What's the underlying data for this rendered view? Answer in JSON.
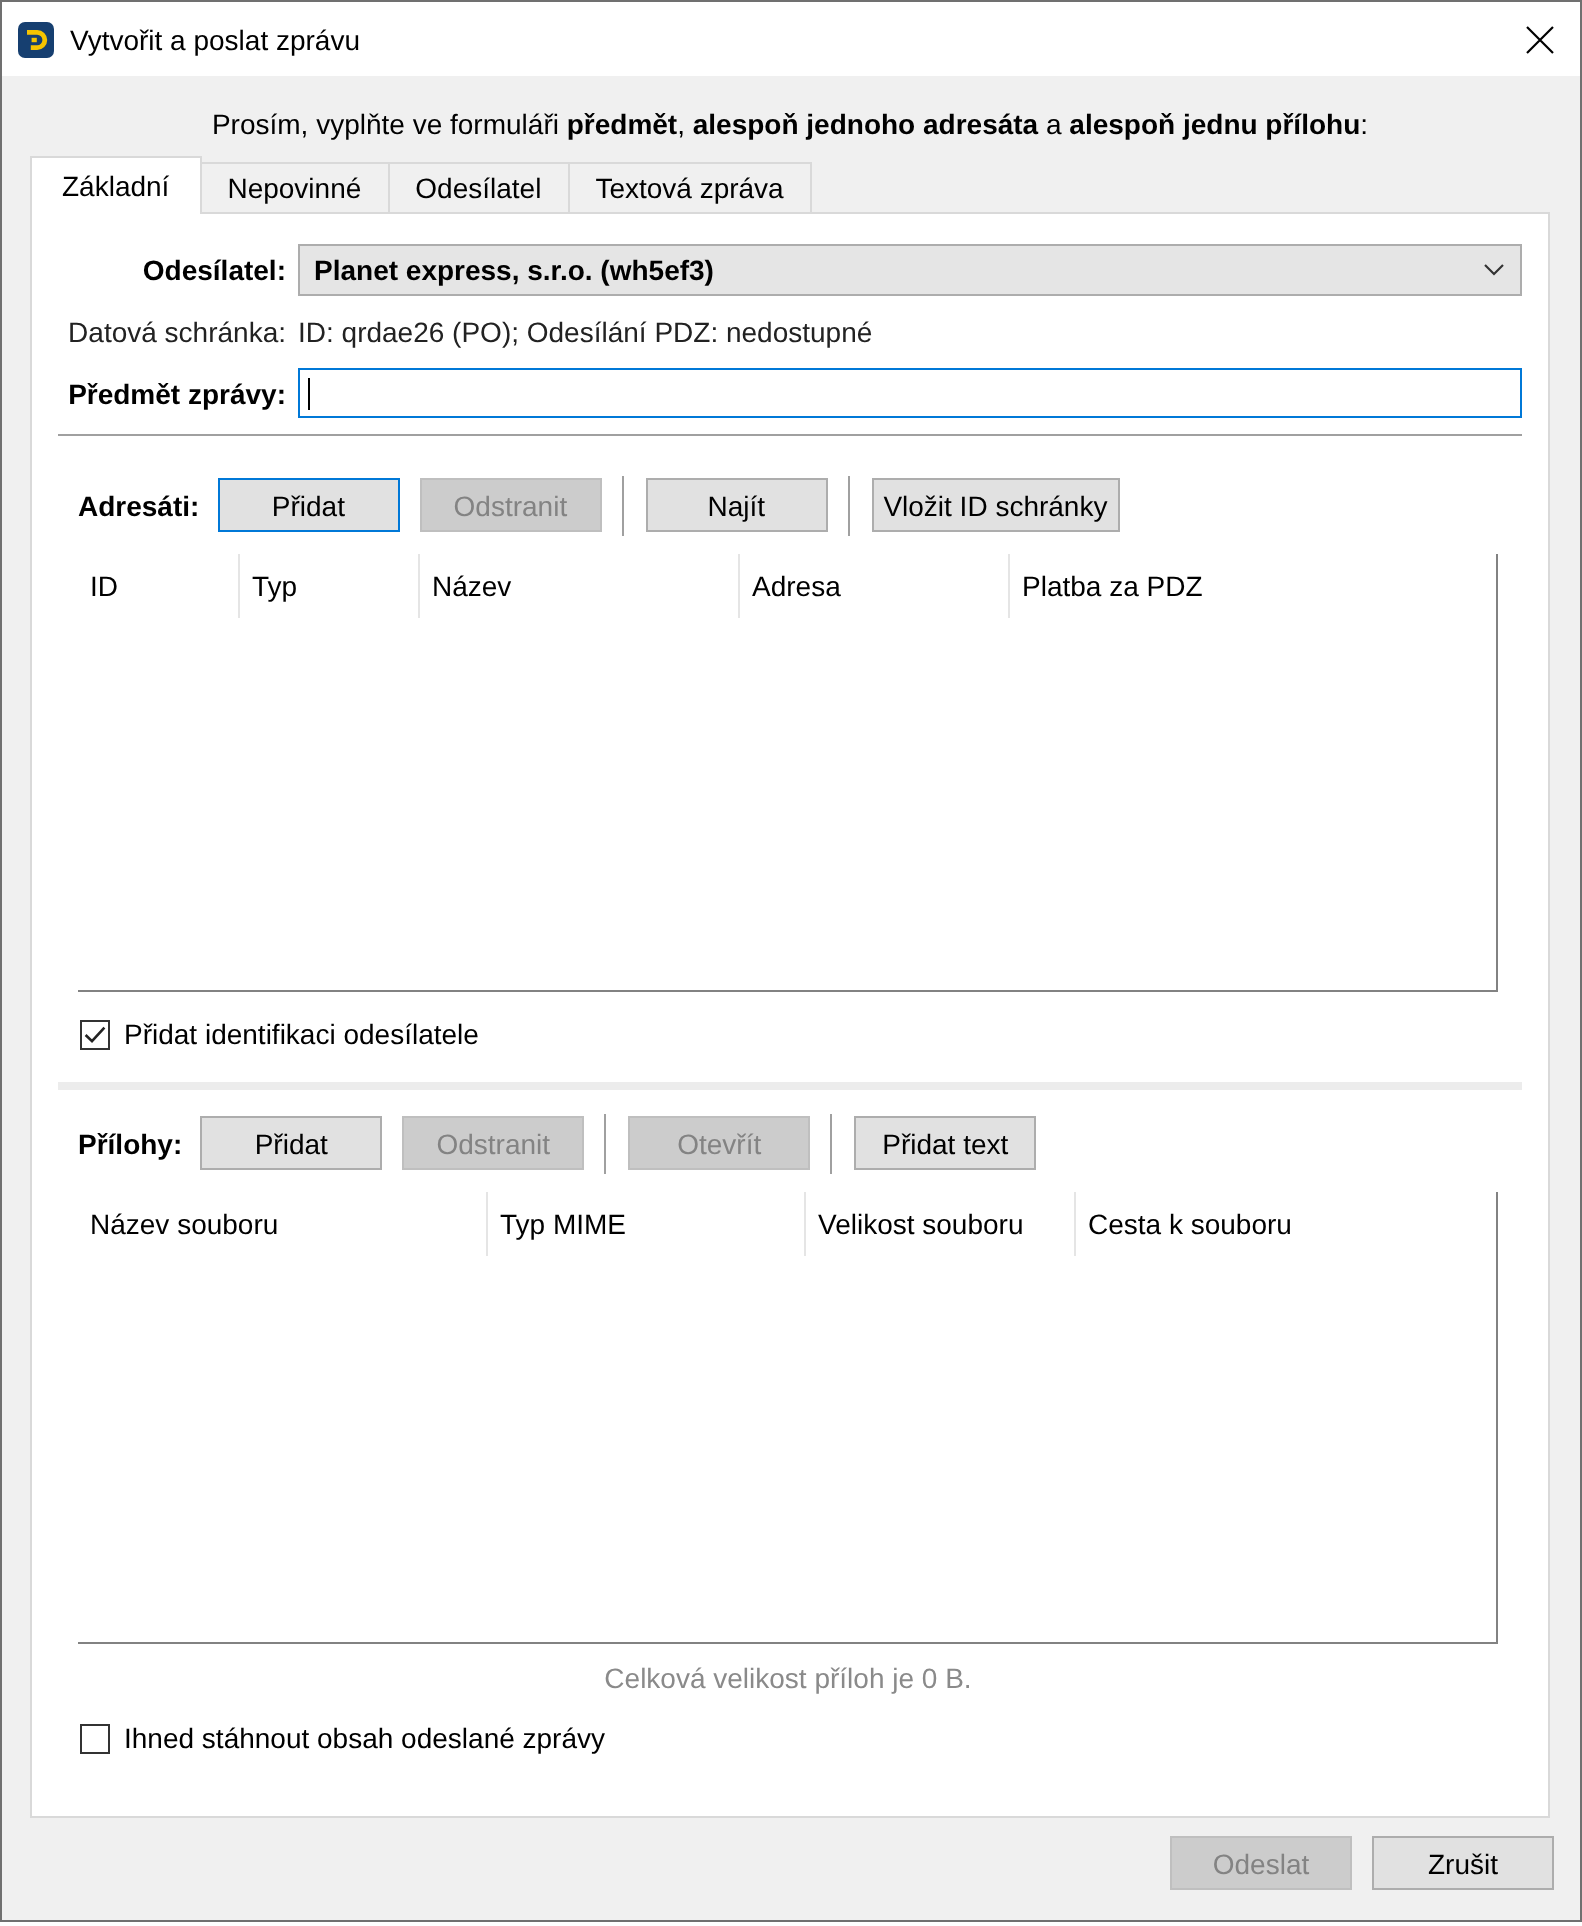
{
  "window": {
    "title": "Vytvořit a poslat zprávu"
  },
  "instruction": "Prosím, vyplňte ve formuláři **předmět**, **alespoň jednoho adresáta** a **alespoň jednu přílohu**:",
  "tabs": [
    {
      "label": "Základní",
      "selected": true
    },
    {
      "label": "Nepovinné",
      "selected": false
    },
    {
      "label": "Odesílatel",
      "selected": false
    },
    {
      "label": "Textová zpráva",
      "selected": false
    }
  ],
  "sender": {
    "label": "Odesílatel:",
    "value": "Planet express, s.r.o. (wh5ef3)"
  },
  "databox": {
    "label": "Datová schránka:",
    "value": "ID: qrdae26 (PO); Odesílání PDZ: nedostupné"
  },
  "subject": {
    "label": "Předmět zprávy:",
    "focused": true
  },
  "recipients": {
    "label": "Adresáti:",
    "toolbar": [
      {
        "kind": "button",
        "label": "Přidat",
        "disabled": false,
        "focused": true
      },
      {
        "kind": "button",
        "label": "Odstranit",
        "disabled": true,
        "focused": false
      },
      {
        "kind": "separator"
      },
      {
        "kind": "button",
        "label": "Najít",
        "disabled": false,
        "focused": false
      },
      {
        "kind": "separator"
      },
      {
        "kind": "button",
        "label": "Vložit ID schránky",
        "disabled": false,
        "focused": false
      }
    ],
    "columns": [
      "ID",
      "Typ",
      "Název",
      "Adresa",
      "Platba za PDZ"
    ]
  },
  "sender_identification": {
    "label": "Přidat identifikaci odesílatele",
    "checked": true
  },
  "attachments": {
    "label": "Přílohy:",
    "toolbar": [
      {
        "kind": "button",
        "label": "Přidat",
        "disabled": false,
        "focused": false
      },
      {
        "kind": "button",
        "label": "Odstranit",
        "disabled": true,
        "focused": false
      },
      {
        "kind": "separator"
      },
      {
        "kind": "button",
        "label": "Otevřít",
        "disabled": true,
        "focused": false
      },
      {
        "kind": "separator"
      },
      {
        "kind": "button",
        "label": "Přidat text",
        "disabled": false,
        "focused": false
      }
    ],
    "columns": [
      "Název souboru",
      "Typ MIME",
      "Velikost souboru",
      "Cesta k souboru"
    ],
    "total": "Celková velikost příloh je 0 B."
  },
  "download_content": {
    "label": "Ihned stáhnout obsah odeslané zprávy",
    "checked": false
  },
  "footer_buttons": [
    {
      "label": "Odeslat",
      "disabled": true
    },
    {
      "label": "Zrušit",
      "disabled": false
    }
  ]
}
